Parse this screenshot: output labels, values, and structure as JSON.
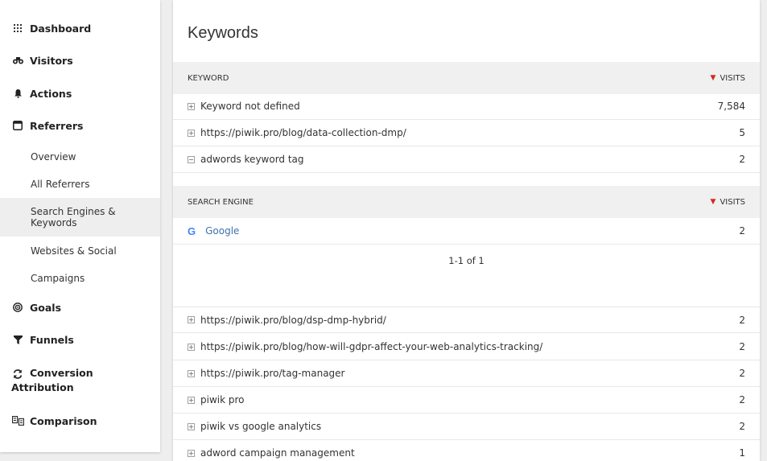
{
  "sidebar": {
    "items": [
      {
        "label": "Dashboard",
        "icon": "dashboard-grid-icon"
      },
      {
        "label": "Visitors",
        "icon": "binoculars-icon"
      },
      {
        "label": "Actions",
        "icon": "bell-icon"
      },
      {
        "label": "Referrers",
        "icon": "window-icon"
      },
      {
        "label": "Goals",
        "icon": "target-icon"
      },
      {
        "label": "Funnels",
        "icon": "funnel-icon"
      },
      {
        "label": "Conversion Attribution",
        "icon": "refresh-icon"
      },
      {
        "label": "Comparison",
        "icon": "compare-icon"
      }
    ],
    "referrers_sub": [
      {
        "label": "Overview"
      },
      {
        "label": "All Referrers"
      },
      {
        "label": "Search Engines & Keywords",
        "active": true
      },
      {
        "label": "Websites & Social"
      },
      {
        "label": "Campaigns"
      }
    ]
  },
  "main": {
    "title": "Keywords",
    "keyword_header": {
      "label": "KEYWORD",
      "sort_label": "VISITS"
    },
    "keyword_rows_top": [
      {
        "label": "Keyword not defined",
        "value": "7,584",
        "expand": "plus"
      },
      {
        "label": "https://piwik.pro/blog/data-collection-dmp/",
        "value": "5",
        "expand": "plus"
      },
      {
        "label": "adwords keyword tag",
        "value": "2",
        "expand": "minus"
      }
    ],
    "engine_header": {
      "label": "SEARCH ENGINE",
      "sort_label": "VISITS"
    },
    "engine_rows": [
      {
        "label": "Google",
        "value": "2",
        "logo": "G"
      }
    ],
    "pager": "1-1 of 1",
    "keyword_rows_bottom": [
      {
        "label": "https://piwik.pro/blog/dsp-dmp-hybrid/",
        "value": "2"
      },
      {
        "label": "https://piwik.pro/blog/how-will-gdpr-affect-your-web-analytics-tracking/",
        "value": "2"
      },
      {
        "label": "https://piwik.pro/tag-manager",
        "value": "2"
      },
      {
        "label": "piwik pro",
        "value": "2"
      },
      {
        "label": "piwik vs google analytics",
        "value": "2"
      },
      {
        "label": "adword campaign management",
        "value": "1"
      }
    ]
  },
  "colors": {
    "sort_arrow": "#d4291f",
    "link": "#3f72af",
    "active_bg": "#eeeeee"
  }
}
